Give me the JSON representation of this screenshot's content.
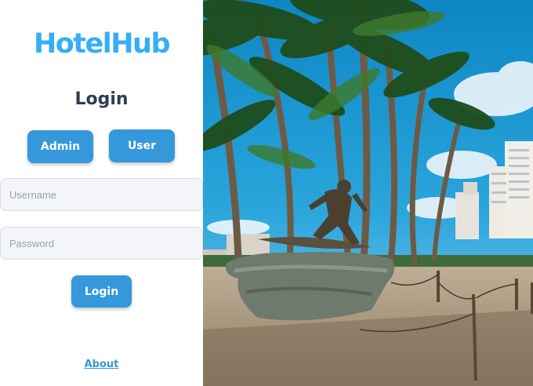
{
  "brand": {
    "name": "HotelHub",
    "color": "#36aef5"
  },
  "login": {
    "title": "Login",
    "role_buttons": {
      "admin": "Admin",
      "user": "User"
    },
    "username_placeholder": "Username",
    "password_placeholder": "Password",
    "submit_label": "Login",
    "accent_color": "#3498db"
  },
  "footer": {
    "about_link": "About"
  },
  "hero": {
    "image_subject": "beach-surfer-statue-palm-trees"
  }
}
